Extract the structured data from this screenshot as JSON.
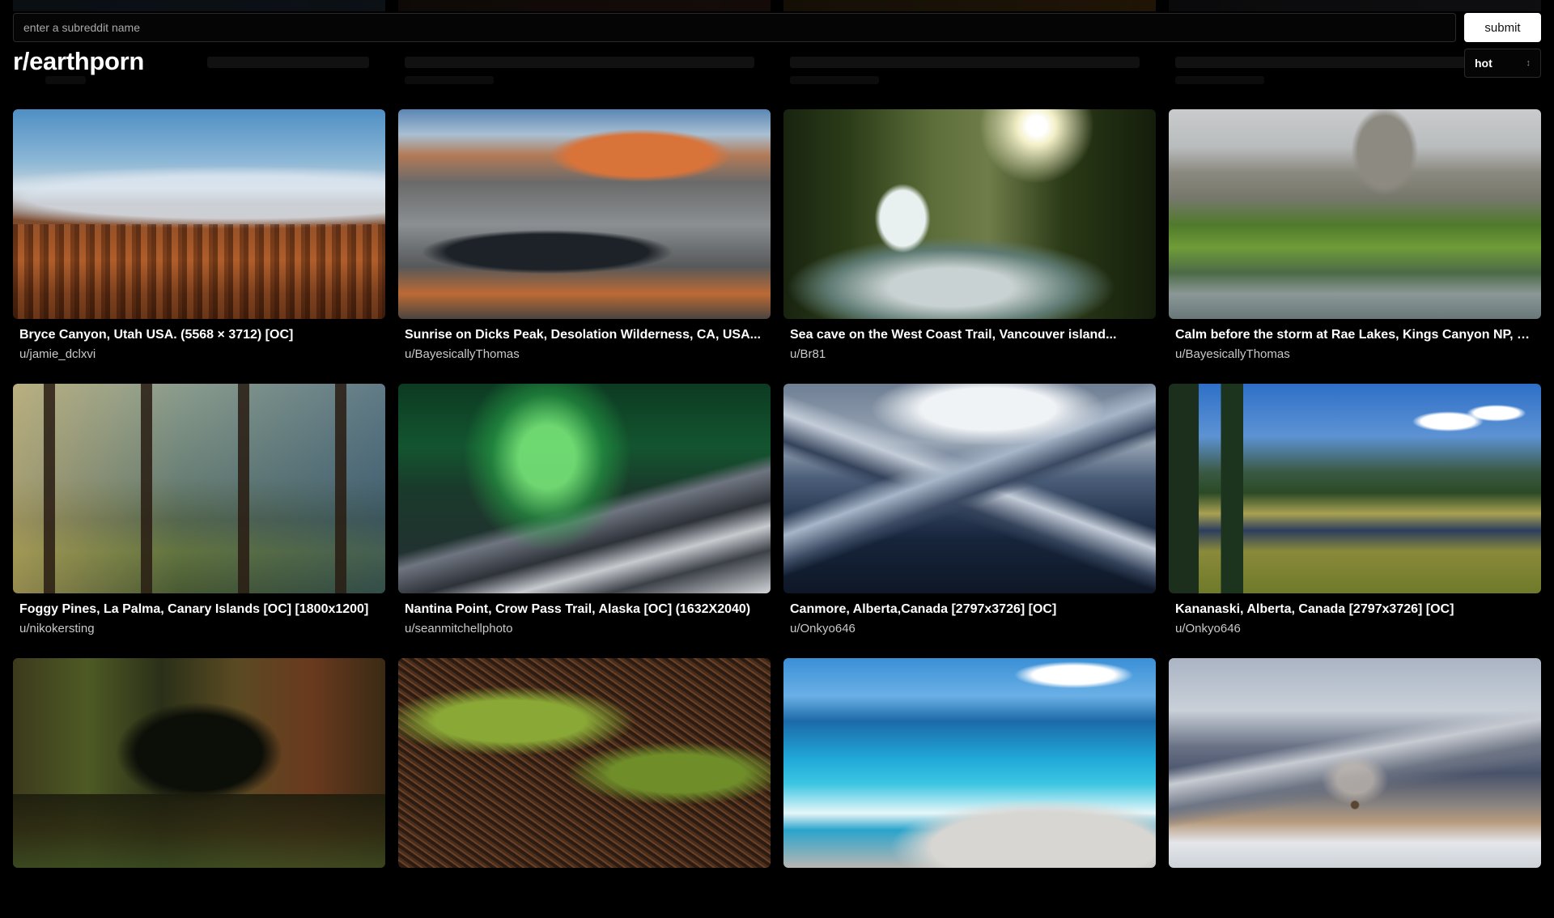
{
  "search": {
    "placeholder": "enter a subreddit name",
    "value": ""
  },
  "submit_label": "submit",
  "subreddit_title": "r/earthporn",
  "sort": {
    "selected": "hot"
  },
  "posts": [
    {
      "title": "Bryce Canyon, Utah USA. (5568 × 3712) [OC]",
      "author": "u/jamie_dclxvi"
    },
    {
      "title": "Sunrise on Dicks Peak, Desolation Wilderness, CA, USA...",
      "author": "u/BayesicallyThomas"
    },
    {
      "title": "Sea cave on the West Coast Trail, Vancouver island...",
      "author": "u/Br81"
    },
    {
      "title": "Calm before the storm at Rae Lakes, Kings Canyon NP, C...",
      "author": "u/BayesicallyThomas"
    },
    {
      "title": "Foggy Pines, La Palma, Canary Islands [OC] [1800x1200]",
      "author": "u/nikokersting"
    },
    {
      "title": "Nantina Point, Crow Pass Trail, Alaska [OC] (1632X2040)",
      "author": "u/seanmitchellphoto"
    },
    {
      "title": "Canmore, Alberta,Canada [2797x3726] [OC]",
      "author": "u/Onkyo646"
    },
    {
      "title": "Kananaski, Alberta, Canada [2797x3726] [OC]",
      "author": "u/Onkyo646"
    },
    {
      "title": "",
      "author": ""
    },
    {
      "title": "",
      "author": ""
    },
    {
      "title": "",
      "author": ""
    },
    {
      "title": "",
      "author": ""
    }
  ],
  "icons": {
    "sort_chevron": "chevron-updown-icon"
  }
}
